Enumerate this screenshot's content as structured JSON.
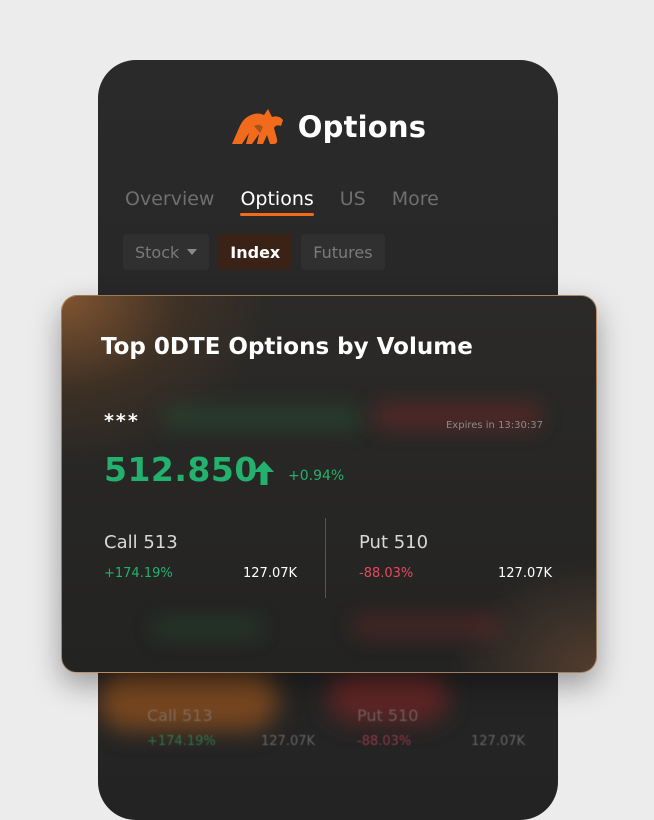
{
  "header": {
    "title": "Options"
  },
  "tabs": [
    "Overview",
    "Options",
    "US",
    "More"
  ],
  "active_tab": "Options",
  "filters": {
    "stock": "Stock",
    "index": "Index",
    "futures": "Futures"
  },
  "card": {
    "title": "Top 0DTE Options by Volume",
    "ticker": "***",
    "expires": "Expires in 13:30:37",
    "price": "512.850",
    "change": "+0.94%",
    "call": {
      "label": "Call 513",
      "change": "+174.19%",
      "volume": "127.07K"
    },
    "put": {
      "label": "Put 510",
      "change": "-88.03%",
      "volume": "127.07K"
    }
  },
  "background_row": {
    "call": {
      "label": "Call 513",
      "change": "+174.19%",
      "volume": "127.07K"
    },
    "put": {
      "label": "Put 510",
      "change": "-88.03%",
      "volume": "127.07K"
    }
  },
  "colors": {
    "accent": "#f26a1b",
    "positive": "#23b26d",
    "negative": "#e8475d"
  },
  "icons": {
    "logo": "bull-logo-icon",
    "price_arrow": "arrow-up-icon",
    "dropdown": "caret-down-icon"
  }
}
